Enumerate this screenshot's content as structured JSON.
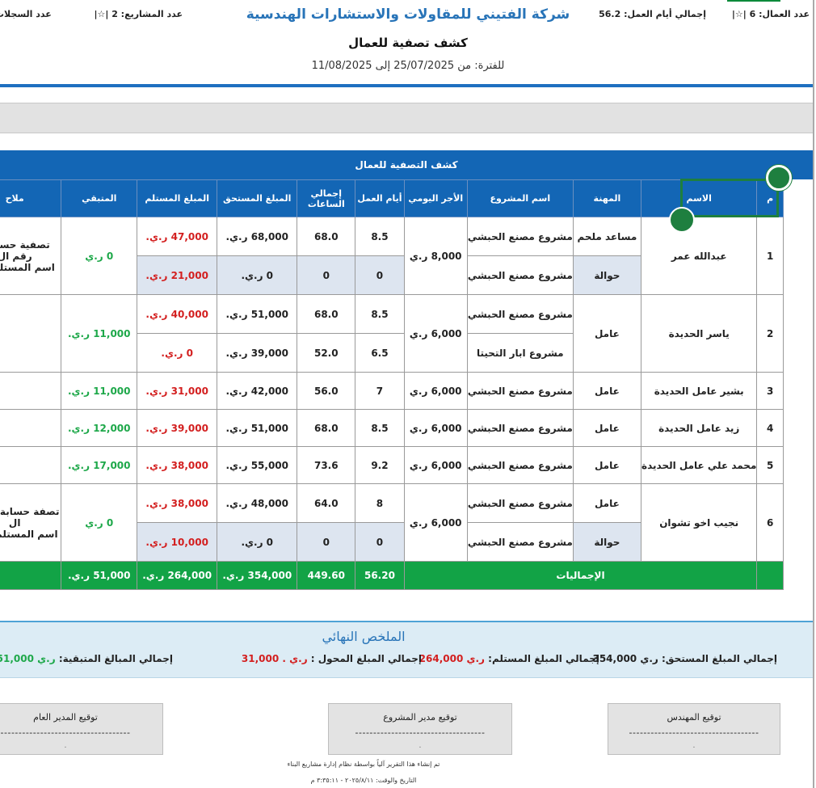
{
  "header": {
    "company": "شركة الفتيني للمقاولات والاستشارات الهندسية",
    "title": "كشف تصفية للعمال",
    "period": "للفترة: من 25/07/2025 إلى 11/08/2025"
  },
  "stats": {
    "workers": "عدد العمال: 6",
    "days": "إجمالي أيام العمل: 56.2",
    "projects": "عدد المشاريع: 2",
    "records": "عدد السجلات",
    "sep": "|☆|"
  },
  "table": {
    "title": "كشف التصفية للعمال",
    "headers": [
      "م",
      "الاسم",
      "المهنة",
      "اسم المشروع",
      "الأجر اليومي",
      "أيام العمل",
      "إجمالي الساعات",
      "المبلغ المستحق",
      "المبلغ المستلم",
      "المتبقي",
      "ملاح"
    ],
    "workers": [
      {
        "no": "1",
        "name": "عبدالله عمر",
        "wage": "8,000 ر.ي",
        "remaining": "0 ر.ي",
        "notes": "تصفية حسابة ، رقم ال\nاسم المستلم : م",
        "rows": [
          {
            "job": "مساعد ملحم",
            "project": "مشروع مصنع الحبشي",
            "days": "8.5",
            "hours": "68.0",
            "due": "68,000 ر.ي.",
            "paid": "47,000 ر.ي."
          },
          {
            "job": "حوالة",
            "project": "مشروع مصنع الحبشي",
            "days": "0",
            "hours": "0",
            "due": "0 ر.ي.",
            "paid": "21,000 ر.ي."
          }
        ]
      },
      {
        "no": "2",
        "name": "ياسر الحديدة",
        "wage": "6,000 ر.ي",
        "remaining": "11,000 ر.ي.",
        "notes": "",
        "rows": [
          {
            "job": "عامل",
            "project": "مشروع مصنع الحبشي",
            "days": "8.5",
            "hours": "68.0",
            "due": "51,000 ر.ي.",
            "paid": "40,000 ر.ي."
          },
          {
            "job": "",
            "project": "مشروع ابار التحيتا",
            "days": "6.5",
            "hours": "52.0",
            "due": "39,000 ر.ي.",
            "paid": "0 ر.ي."
          }
        ]
      },
      {
        "no": "3",
        "name": "بشير عامل الحديدة",
        "wage": "6,000 ر.ي",
        "remaining": "11,000 ر.ي.",
        "notes": "",
        "rows": [
          {
            "job": "عامل",
            "project": "مشروع مصنع الحبشي",
            "days": "7",
            "hours": "56.0",
            "due": "42,000 ر.ي.",
            "paid": "31,000 ر.ي."
          }
        ]
      },
      {
        "no": "4",
        "name": "زيد عامل الحديدة",
        "wage": "6,000 ر.ي",
        "remaining": "12,000 ر.ي.",
        "notes": "",
        "rows": [
          {
            "job": "عامل",
            "project": "مشروع مصنع الحبشي",
            "days": "8.5",
            "hours": "68.0",
            "due": "51,000 ر.ي.",
            "paid": "39,000 ر.ي."
          }
        ]
      },
      {
        "no": "5",
        "name": "محمد علي عامل الحديدة",
        "wage": "6,000 ر.ي",
        "remaining": "17,000 ر.ي.",
        "notes": "",
        "rows": [
          {
            "job": "عامل",
            "project": "مشروع مصنع الحبشي",
            "days": "9.2",
            "hours": "73.6",
            "due": "55,000 ر.ي.",
            "paid": "38,000 ر.ي."
          }
        ]
      },
      {
        "no": "6",
        "name": "نجيب اخو تشوان",
        "wage": "6,000 ر.ي",
        "remaining": "0 ر.ي",
        "notes": "تصفة حسابة ، رقم ال\nاسم المستلم : مح",
        "rows": [
          {
            "job": "عامل",
            "project": "مشروع مصنع الحبشي",
            "days": "8",
            "hours": "64.0",
            "due": "48,000 ر.ي.",
            "paid": "38,000 ر.ي."
          },
          {
            "job": "حوالة",
            "project": "مشروع مصنع الحبشي",
            "days": "0",
            "hours": "0",
            "due": "0 ر.ي.",
            "paid": "10,000 ر.ي."
          }
        ]
      }
    ],
    "totals": {
      "label": "الإجماليات",
      "days": "56.20",
      "hours": "449.60",
      "due": "354,000 ر.ي.",
      "paid": "264,000 ر.ي.",
      "remaining": "51,000 ر.ي."
    }
  },
  "summary": {
    "title": "الملخص النهائي",
    "due_label": "إجمالي المبلغ المستحق:",
    "due_value": "ر.ي 354,000",
    "paid_label": "إجمالي المبلغ المستلم:",
    "paid_value": "ر.ي 264,000",
    "transfer_label": "إجمالي المبلغ المحول :",
    "transfer_value": "ر.ي . 31,000",
    "remaining_label": "إجمالي المبالغ المتبقية:",
    "remaining_value": "ر.ي 51,000"
  },
  "signatures": {
    "engineer": "توقيع المهندس",
    "project_manager": "توقيع مدير المشروع",
    "general_manager": "توقيع المدير العام",
    "line": "------------------------------------",
    "dot": "."
  },
  "footer": {
    "line1": "تم إنشاء هذا التقرير آلياً بواسطة نظام إدارة مشاريع البناء",
    "line2": "التاريخ والوقت: ٢٠٢٥/٨/١١ - ٣:٣٥:١١ م"
  },
  "colors": {
    "blue": "#1366b5",
    "green": "#12a346",
    "red": "#d31f1f",
    "accent_green": "#1ea84a"
  }
}
